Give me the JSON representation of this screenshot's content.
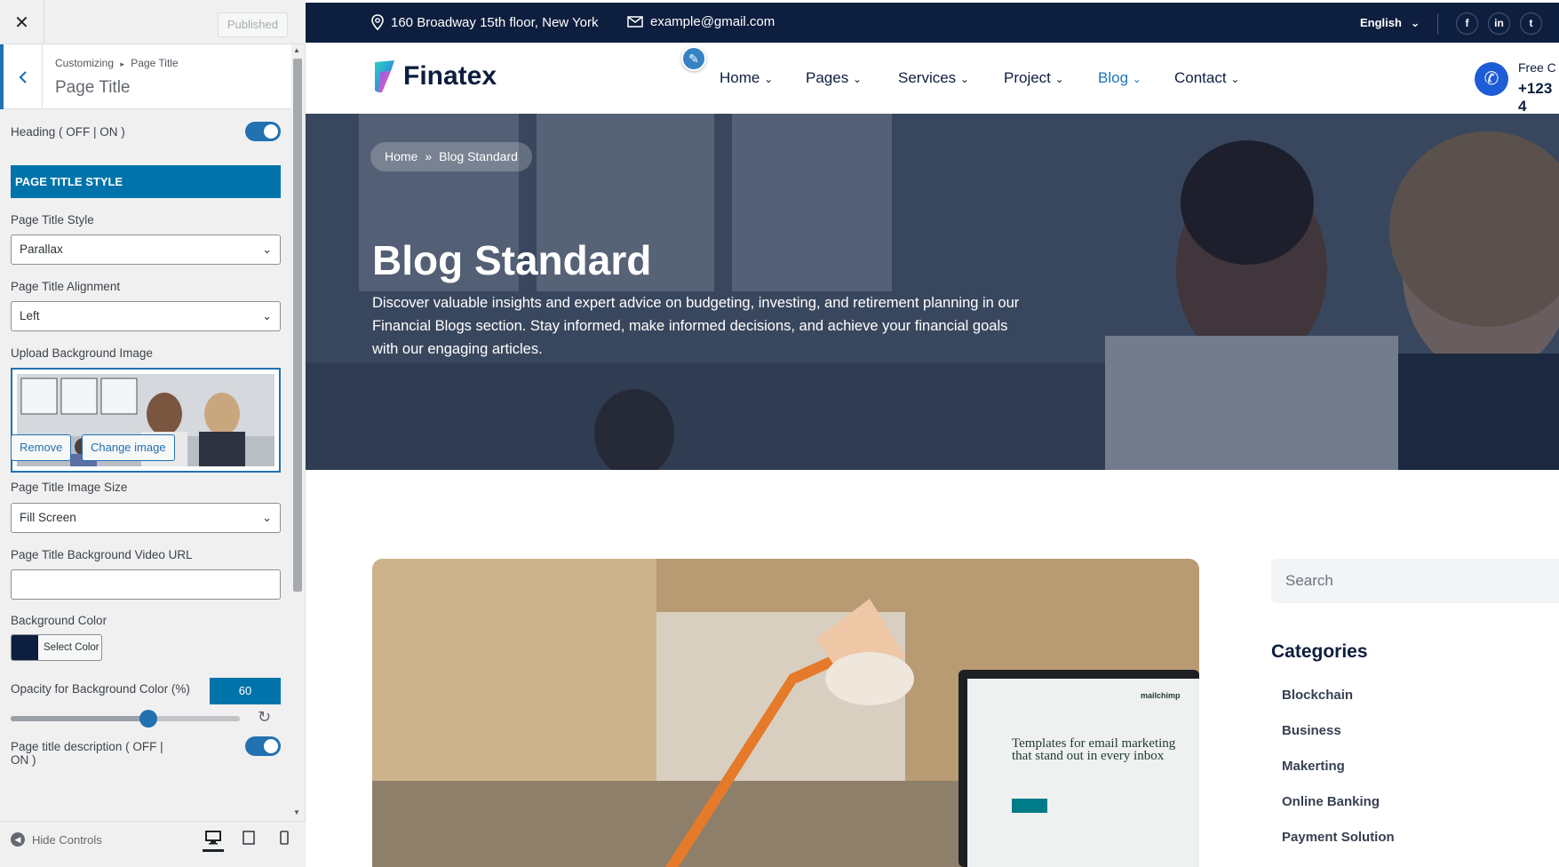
{
  "customizer": {
    "close_label": "✕",
    "published_label": "Published",
    "breadcrumb": {
      "root": "Customizing",
      "sep": "▸",
      "current": "Page Title"
    },
    "section_title": "Page Title",
    "heading_toggle_label": "Heading ( OFF | ON )",
    "heading_toggle_on": true,
    "page_title_style_bar": "PAGE TITLE STYLE",
    "page_title_style_label": "Page Title Style",
    "page_title_style_value": "Parallax",
    "page_title_alignment_label": "Page Title Alignment",
    "page_title_alignment_value": "Left",
    "upload_bg_label": "Upload Background Image",
    "remove_label": "Remove",
    "change_image_label": "Change image",
    "image_size_label": "Page Title Image Size",
    "image_size_value": "Fill Screen",
    "video_url_label": "Page Title Background Video URL",
    "video_url_value": "",
    "bg_color_label": "Background Color",
    "bg_color_value": "#0e1e3f",
    "select_color_label": "Select Color",
    "opacity_label": "Opacity for Background Color (%)",
    "opacity_value": "60",
    "opacity_slider_fraction": 0.6,
    "description_toggle_label": "Page title description ( OFF |",
    "description_toggle_label_cont": "ON )",
    "description_toggle_on": true,
    "hide_controls_label": "Hide Controls",
    "accent_color": "#2271b1"
  },
  "site": {
    "topbar": {
      "address": "160 Broadway 15th floor, New York",
      "email": "example@gmail.com",
      "language": "English",
      "social": [
        "f",
        "in",
        "t"
      ],
      "background": "#0e1e3f"
    },
    "logo_text": "Finatex",
    "nav": [
      {
        "label": "Home",
        "active": false
      },
      {
        "label": "Pages",
        "active": false
      },
      {
        "label": "Services",
        "active": false
      },
      {
        "label": "Project",
        "active": false
      },
      {
        "label": "Blog",
        "active": true
      },
      {
        "label": "Contact",
        "active": false
      }
    ],
    "call_label": "Free C",
    "call_number": "+123 4",
    "hero": {
      "breadcrumb_home": "Home",
      "breadcrumb_sep": "»",
      "breadcrumb_current": "Blog Standard",
      "title": "Blog Standard",
      "description": "Discover valuable insights and expert advice on budgeting, investing, and retirement planning in our Financial Blogs section. Stay informed, make informed decisions, and achieve your financial goals with our engaging articles."
    },
    "post_laptop_text": "Templates for email marketing that stand out in every inbox",
    "post_laptop_brand": "mailchimp",
    "sidebar": {
      "search_placeholder": "Search",
      "categories_title": "Categories",
      "categories": [
        "Blockchain",
        "Business",
        "Makerting",
        "Online Banking",
        "Payment Solution"
      ]
    }
  }
}
